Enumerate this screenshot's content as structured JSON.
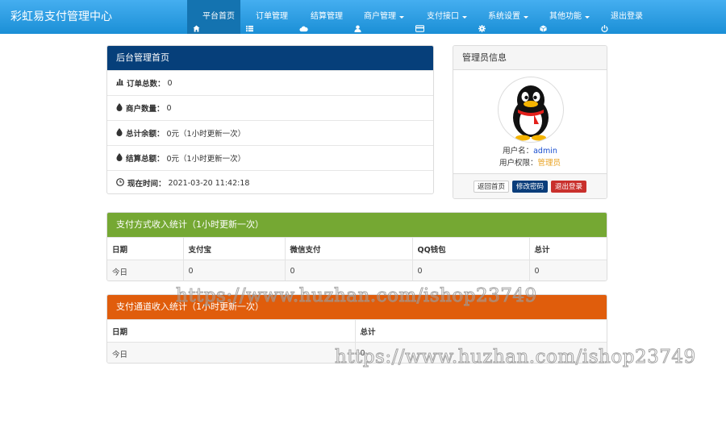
{
  "brand": "彩虹易支付管理中心",
  "nav": [
    {
      "label": "平台首页",
      "icon": "home-icon",
      "active": true,
      "dropdown": false
    },
    {
      "label": "订单管理",
      "icon": "list-icon",
      "active": false,
      "dropdown": false
    },
    {
      "label": "结算管理",
      "icon": "cloud-icon",
      "active": false,
      "dropdown": false
    },
    {
      "label": "商户管理",
      "icon": "user-icon",
      "active": false,
      "dropdown": true
    },
    {
      "label": "支付接口",
      "icon": "credit-card-icon",
      "active": false,
      "dropdown": true
    },
    {
      "label": "系统设置",
      "icon": "gear-icon",
      "active": false,
      "dropdown": true
    },
    {
      "label": "其他功能",
      "icon": "cube-icon",
      "active": false,
      "dropdown": true
    },
    {
      "label": "退出登录",
      "icon": "power-icon",
      "active": false,
      "dropdown": false
    }
  ],
  "home_panel": {
    "title": "后台管理首页",
    "rows": [
      {
        "icon": "bar-chart-icon",
        "label": "订单总数：",
        "value": "0"
      },
      {
        "icon": "drop-icon",
        "label": "商户数量：",
        "value": "0"
      },
      {
        "icon": "drop-icon",
        "label": "总计余额：",
        "value": "0元（1小时更新一次）"
      },
      {
        "icon": "drop-icon",
        "label": "结算总额：",
        "value": "0元（1小时更新一次）"
      },
      {
        "icon": "clock-icon",
        "label": "现在时间：",
        "value": "2021-03-20 11:42:18"
      }
    ]
  },
  "admin_panel": {
    "title": "管理员信息",
    "username_label": "用户名：",
    "username": "admin",
    "role_label": "用户权限：",
    "role": "管理员",
    "btn_home": "返回首页",
    "btn_password": "修改密码",
    "btn_logout": "退出登录"
  },
  "pay_stats": {
    "title": "支付方式收入统计（1小时更新一次）",
    "headers": [
      "日期",
      "支付宝",
      "微信支付",
      "QQ钱包",
      "总计"
    ],
    "rows": [
      [
        "今日",
        "0",
        "0",
        "0",
        "0"
      ]
    ]
  },
  "channel_stats": {
    "title": "支付通道收入统计（1小时更新一次）",
    "headers": [
      "日期",
      "总计"
    ],
    "rows": [
      [
        "今日",
        "0"
      ]
    ]
  },
  "watermark": "https://www.huzhan.com/ishop23749",
  "colors": {
    "navbar": "#2f9ee0",
    "nav_active": "#1473b0",
    "home_head": "#063f7a",
    "pay_head": "#75a833",
    "channel_head": "#e05d0c",
    "btn_primary": "#0a3d7a",
    "btn_danger": "#c9302c"
  }
}
